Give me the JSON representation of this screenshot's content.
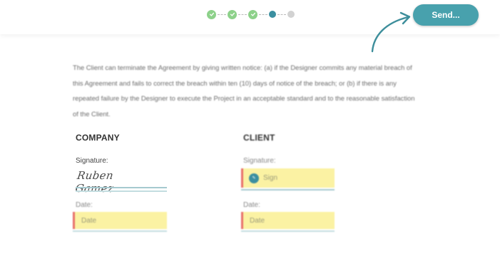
{
  "progress": {
    "steps": [
      {
        "state": "done",
        "icon": "check-icon"
      },
      {
        "state": "done",
        "icon": "check-icon"
      },
      {
        "state": "done",
        "icon": "check-icon"
      },
      {
        "state": "current"
      },
      {
        "state": "pending"
      }
    ]
  },
  "toolbar": {
    "send_label": "Send..."
  },
  "document": {
    "paragraph": "The Client can terminate the Agreement by giving written notice: (a) if the Designer commits any material breach of this Agreement and fails to correct the breach within ten (10) days of notice of the breach; or (b) if there is any repeated failure by the Designer to execute the Project in an acceptable standard and to the reasonable satisfaction of the Client."
  },
  "company": {
    "title": "COMPANY",
    "signature_label": "Signature:",
    "signature_value": "Ruben Gamez",
    "date_label": "Date:",
    "date_placeholder": "Date"
  },
  "client": {
    "title": "CLIENT",
    "signature_label": "Signature:",
    "sign_placeholder": "Sign",
    "sign_icon": "pen-icon",
    "date_label": "Date:",
    "date_placeholder": "Date"
  },
  "colors": {
    "accent": "#48a1ad",
    "step_done": "#8dd18a",
    "step_current": "#3b8fa0",
    "field_fill": "#fbf2a3",
    "field_marker": "#e8706a"
  }
}
